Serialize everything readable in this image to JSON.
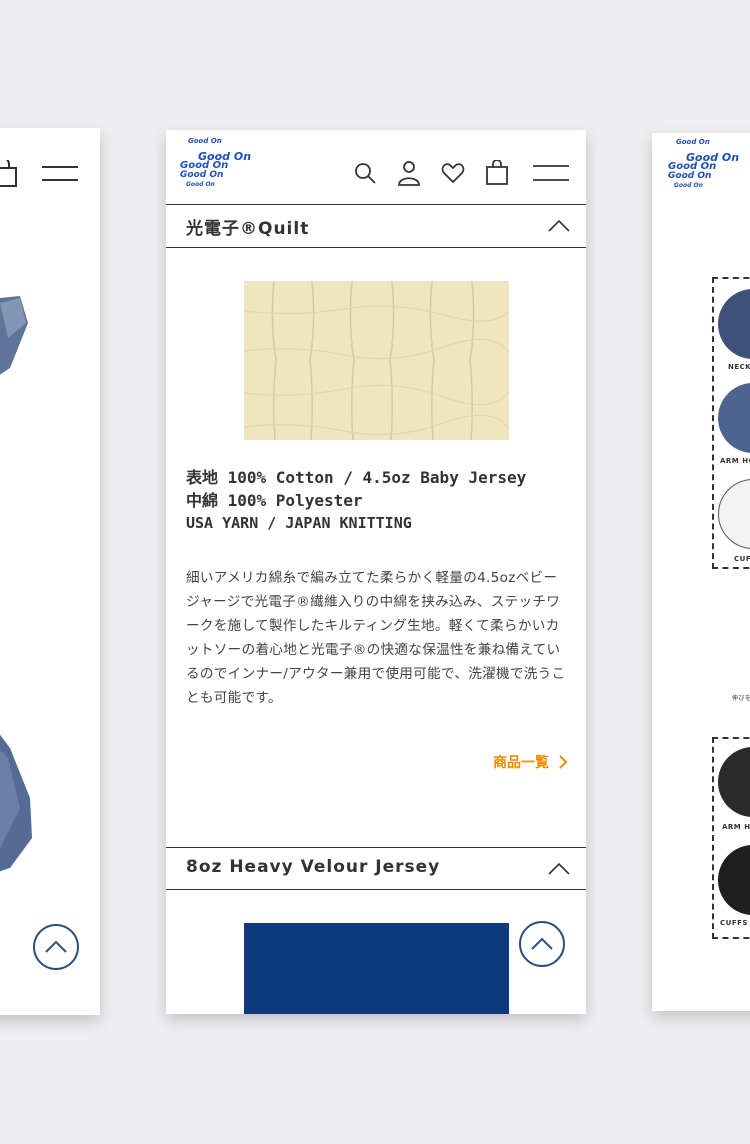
{
  "brand": {
    "logo_lines": [
      "Good On",
      "Good On",
      "Good On",
      "Good On",
      "Good On"
    ]
  },
  "header": {
    "icons": [
      "search-icon",
      "user-icon",
      "heart-icon",
      "bag-icon",
      "menu-icon"
    ]
  },
  "sections": [
    {
      "title": "光電子®Quilt",
      "spec_lines": [
        "表地 100% Cotton / 4.5oz Baby Jersey",
        "中綿 100% Polyester",
        "USA YARN / JAPAN KNITTING"
      ],
      "description": "細いアメリカ綿糸で編み立てた柔らかく軽量の4.5ozベビージャージで光電子®繊維入りの中綿を挟み込み、ステッチワークを施して製作したキルティング生地。軽くて柔らかいカットソーの着心地と光電子®の快適な保温性を兼ね備えているのでインナー/アウター兼用で使用可能で、洗濯機で洗うことも可能です。",
      "link_label": "商品一覧",
      "swatch_color": "#f1e4c0"
    },
    {
      "title": "8oz Heavy Velour Jersey",
      "swatch_color": "#0f3e86"
    }
  ],
  "right_screen": {
    "labels": [
      "NECK",
      "ARM HO",
      "CUF",
      "ARM HO",
      "CUFFS I"
    ],
    "note": "伸びを"
  },
  "colors": {
    "accent": "#f08a00",
    "brand_blue": "#1f4fb8",
    "navy": "#2e4f7d"
  }
}
